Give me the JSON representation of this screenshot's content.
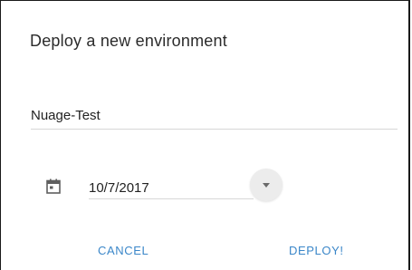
{
  "dialog": {
    "title": "Deploy a new environment",
    "name_value": "Nuage-Test",
    "date_value": "10/7/2017",
    "cancel_label": "CANCEL",
    "deploy_label": "DEPLOY!"
  },
  "icons": {
    "date": "calendar-icon",
    "dropdown": "arrow-drop-down-icon"
  },
  "colors": {
    "accent": "#3b87c9",
    "text": "#222222",
    "divider": "#d7d7d7"
  }
}
